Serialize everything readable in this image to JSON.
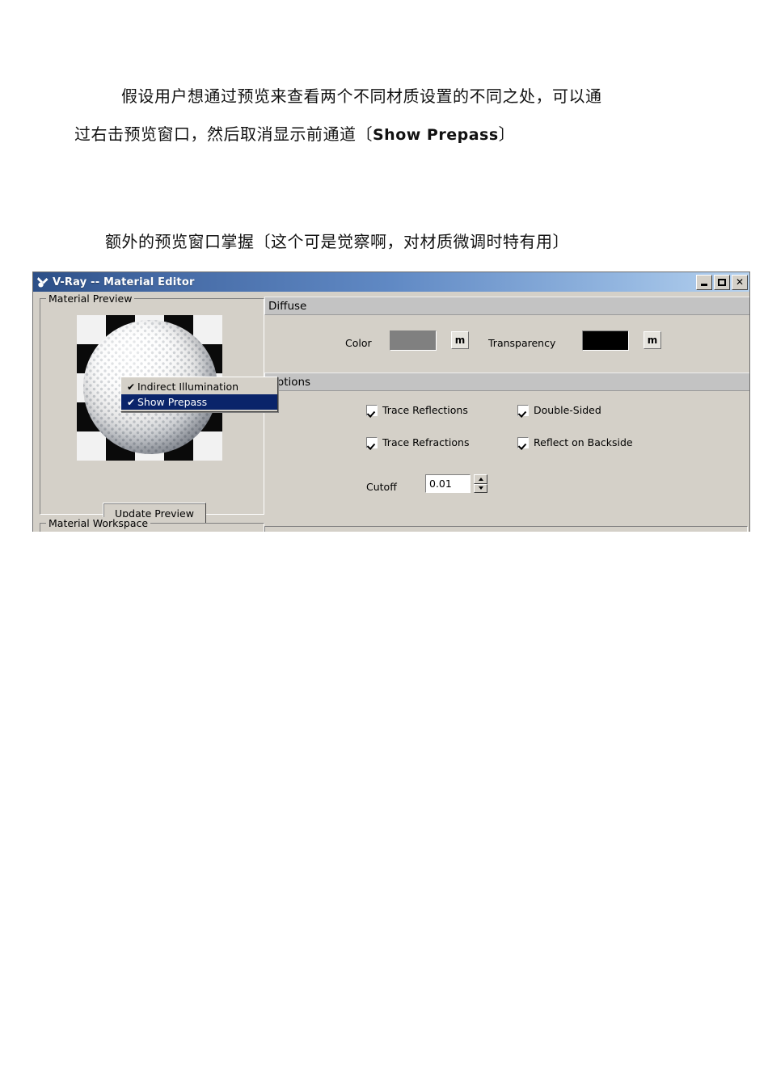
{
  "document": {
    "paragraph1_line1": "假设用户想通过预览来查看两个不同材质设置的不同之处，可以通",
    "paragraph1_line2_prefix": "过右击预览窗口，然后取消显示前通道〔",
    "paragraph1_line2_emphasis": "Show Prepass",
    "paragraph1_line2_suffix": "〕",
    "paragraph2": "额外的预览窗口掌握〔这个可是觉察啊，对材质微调时特有用〕"
  },
  "window": {
    "title": "V-Ray -- Material Editor",
    "icon": "vray-logo-icon",
    "titlebar_gradient_start": "#2c4f87",
    "titlebar_gradient_end": "#b6d2ef",
    "face_color": "#d4d0c8",
    "buttons": {
      "minimize": "minimize",
      "maximize": "maximize",
      "close": "✕"
    }
  },
  "material_preview": {
    "group_title": "Material Preview",
    "update_button": "Update Preview",
    "preview_content": "golf-ball-on-checkerboard"
  },
  "material_workspace": {
    "group_title": "Material Workspace"
  },
  "context_menu": {
    "items": [
      {
        "label": "Indirect Illumination",
        "checked": true,
        "check_glyph": "✔",
        "highlighted": false
      },
      {
        "label": "Show Prepass",
        "checked": true,
        "check_glyph": "✔",
        "highlighted": true
      }
    ],
    "highlight_color": "#0a246a"
  },
  "diffuse": {
    "header": "Diffuse",
    "color_label": "Color",
    "color_value": "#808080",
    "color_map_button": "m",
    "transparency_label": "Transparency",
    "transparency_value": "#000000",
    "transparency_map_button": "m"
  },
  "options": {
    "header": "Options",
    "checkboxes": [
      {
        "label": "Trace Reflections",
        "checked": true
      },
      {
        "label": "Double-Sided",
        "checked": true
      },
      {
        "label": "Trace Refractions",
        "checked": true
      },
      {
        "label": "Reflect on Backside",
        "checked": true
      }
    ],
    "cutoff_label": "Cutoff",
    "cutoff_value": "0.01"
  }
}
